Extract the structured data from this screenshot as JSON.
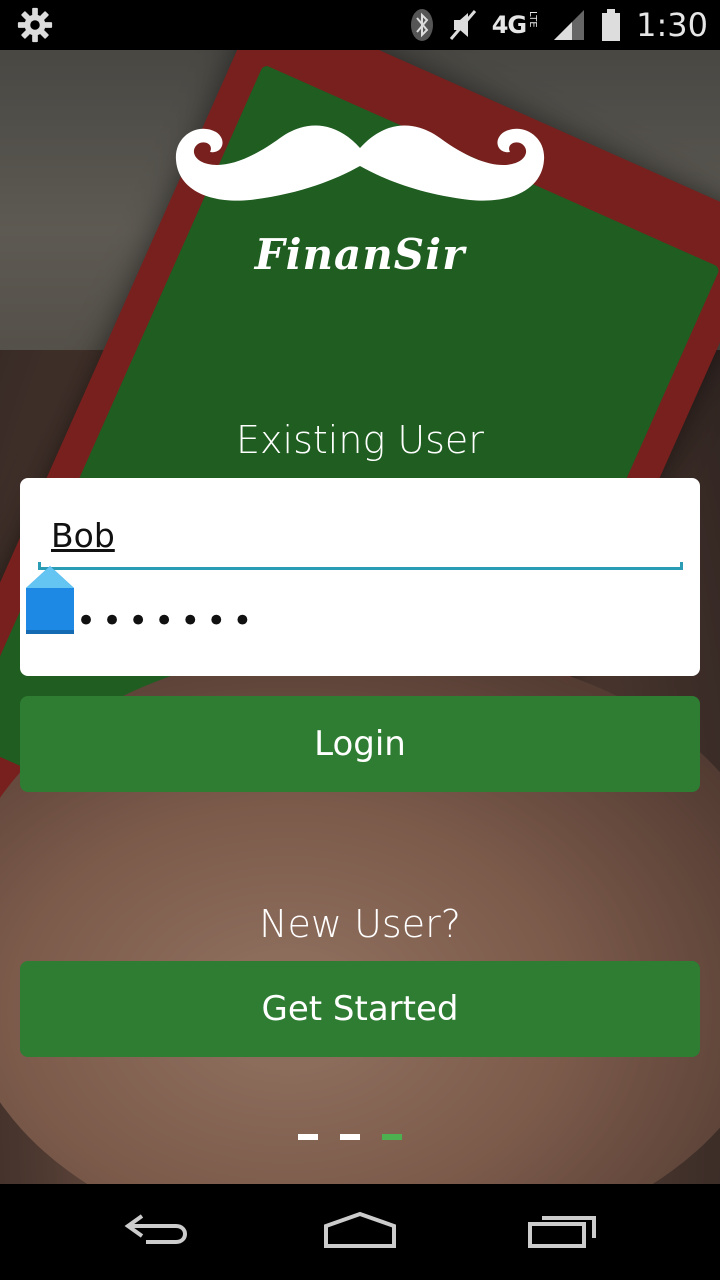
{
  "status_bar": {
    "network": "4G",
    "network_sub": "LTE",
    "time": "1:30",
    "icons": [
      "gear-icon",
      "bluetooth-icon",
      "mute-icon",
      "signal-icon",
      "battery-icon"
    ]
  },
  "logo": {
    "icon": "mustache-icon",
    "brand": "FinanSir"
  },
  "login": {
    "section_label": "Existing User",
    "username_value": "Bob",
    "password_mask": "•••••••",
    "button_label": "Login"
  },
  "signup": {
    "section_label": "New User?",
    "button_label": "Get Started"
  },
  "pager": {
    "count": 3,
    "active_index": 2
  },
  "nav_bar": {
    "icons": [
      "back-icon",
      "home-icon",
      "recent-apps-icon"
    ]
  },
  "colors": {
    "button_green": "#2e7d32",
    "focus_underline": "#2a9cb3",
    "pager_active": "#4caf50",
    "cursor_handle": "#1e88e5"
  }
}
